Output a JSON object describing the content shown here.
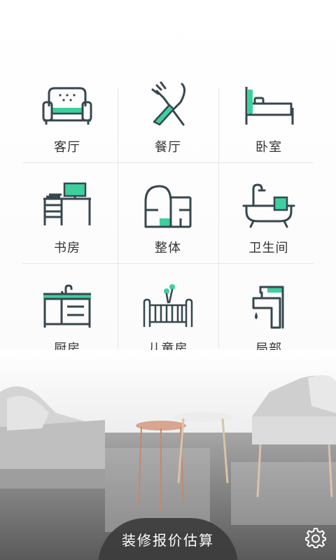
{
  "rooms": [
    {
      "label": "客厅",
      "icon": "sofa-icon"
    },
    {
      "label": "餐厅",
      "icon": "fork-knife-icon"
    },
    {
      "label": "卧室",
      "icon": "bed-icon"
    },
    {
      "label": "书房",
      "icon": "desk-computer-icon"
    },
    {
      "label": "整体",
      "icon": "floor-plan-icon"
    },
    {
      "label": "卫生间",
      "icon": "bathtub-icon"
    },
    {
      "label": "厨房",
      "icon": "kitchen-counter-icon"
    },
    {
      "label": "儿童房",
      "icon": "crib-balloon-icon"
    },
    {
      "label": "局部",
      "icon": "faucet-icon"
    }
  ],
  "cta": {
    "label": "装修报价估算"
  },
  "settings": {
    "icon": "gear-icon"
  },
  "colors": {
    "accent": "#3ecf9f",
    "stroke": "#37474f",
    "cta_bg": "#3c3c3c"
  }
}
